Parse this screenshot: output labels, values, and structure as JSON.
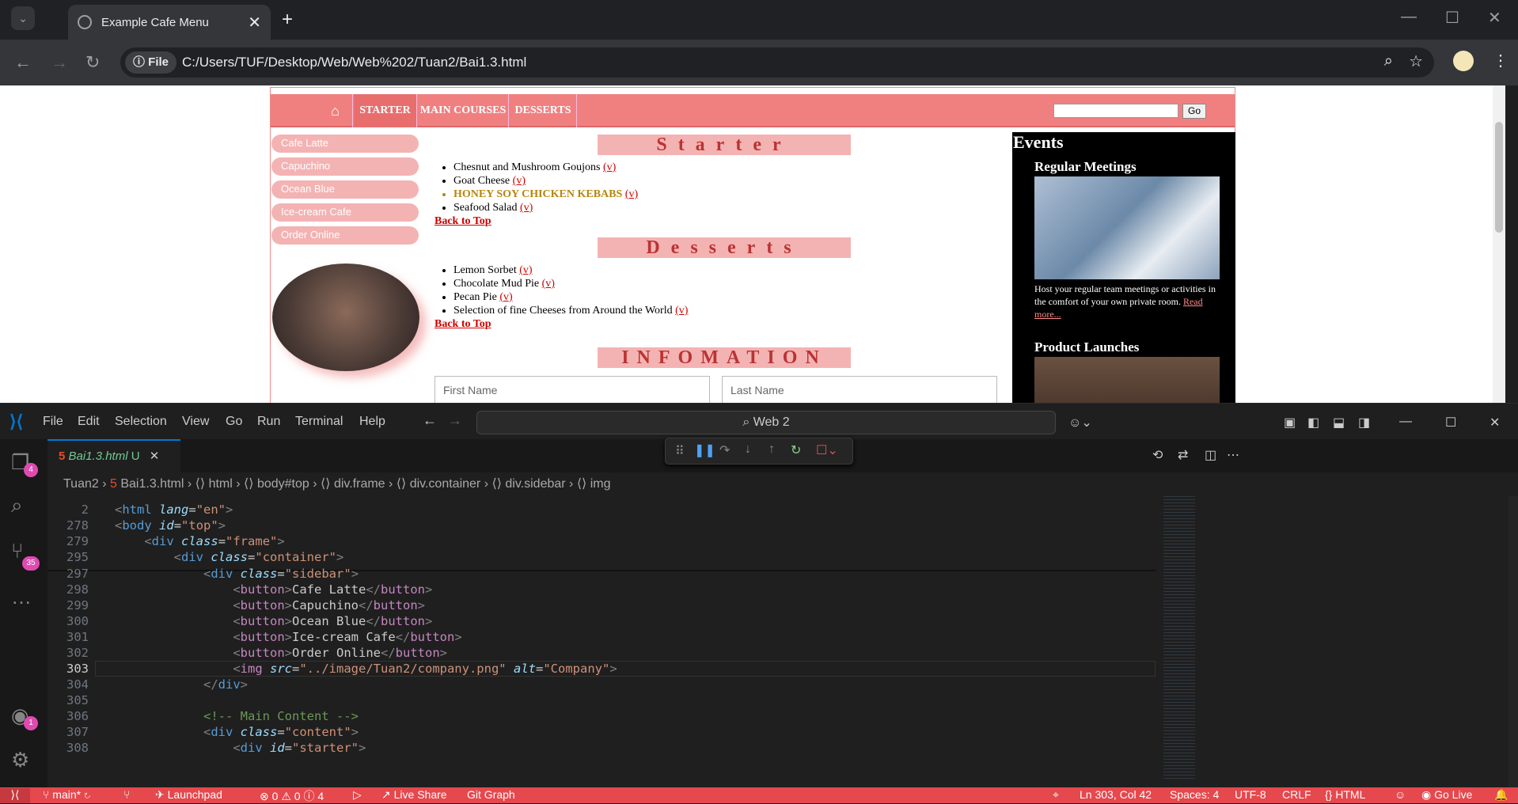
{
  "browser": {
    "tab_title": "Example Cafe Menu",
    "site_chip": "File",
    "url": "C:/Users/TUF/Desktop/Web/Web%202/Tuan2/Bai1.3.html"
  },
  "page": {
    "nav": [
      "STARTER",
      "MAIN COURSES",
      "DESSERTS"
    ],
    "go_label": "Go",
    "sidebar": [
      "Cafe Latte",
      "Capuchino",
      "Ocean Blue",
      "Ice-cream Cafe",
      "Order Online"
    ],
    "starter_heading": "Starter",
    "starter_items": [
      {
        "name": "Chesnut and Mushroom Goujons",
        "tag": "(v)"
      },
      {
        "name": "Goat Cheese",
        "tag": "(v)"
      },
      {
        "name": "HONEY SOY CHICKEN KEBABS",
        "tag": "(v)"
      },
      {
        "name": "Seafood Salad",
        "tag": "(v)"
      }
    ],
    "back_to_top": "Back to Top",
    "desserts_heading": "Desserts",
    "dessert_items": [
      {
        "name": "Lemon Sorbet",
        "tag": "(v)"
      },
      {
        "name": "Chocolate Mud Pie",
        "tag": "(v)"
      },
      {
        "name": "Pecan Pie",
        "tag": "(v)"
      },
      {
        "name": "Selection of fine Cheeses from Around the World",
        "tag": "(v)"
      }
    ],
    "info_heading": "INFOMATION",
    "first_name": "First Name",
    "last_name": "Last Name",
    "events": {
      "title": "Events",
      "item1_title": "Regular Meetings",
      "item1_text": "Host your regular team meetings or activities in the comfort of your own private room.",
      "item1_link": "Read more...",
      "item2_title": "Product Launches"
    }
  },
  "vscode": {
    "menu": [
      "File",
      "Edit",
      "Selection",
      "View",
      "Go",
      "Run",
      "Terminal",
      "Help"
    ],
    "search": "Web 2",
    "tab_name": "Bai1.3.html",
    "tab_status": "U",
    "breadcrumb": [
      "Tuan2",
      "Bai1.3.html",
      "html",
      "body#top",
      "div.frame",
      "div.container",
      "div.sidebar",
      "img"
    ],
    "badges": {
      "explorer": "4",
      "scm": "35",
      "accounts": "1"
    },
    "status": {
      "branch": "main*",
      "launchpad": "Launchpad",
      "problems": "0",
      "warnings": "0",
      "info": "4",
      "live_share": "Live Share",
      "git_graph": "Git Graph",
      "position": "Ln 303, Col 42",
      "spaces": "Spaces: 4",
      "encoding": "UTF-8",
      "eol": "CRLF",
      "lang": "HTML",
      "go_live": "Go Live"
    }
  }
}
